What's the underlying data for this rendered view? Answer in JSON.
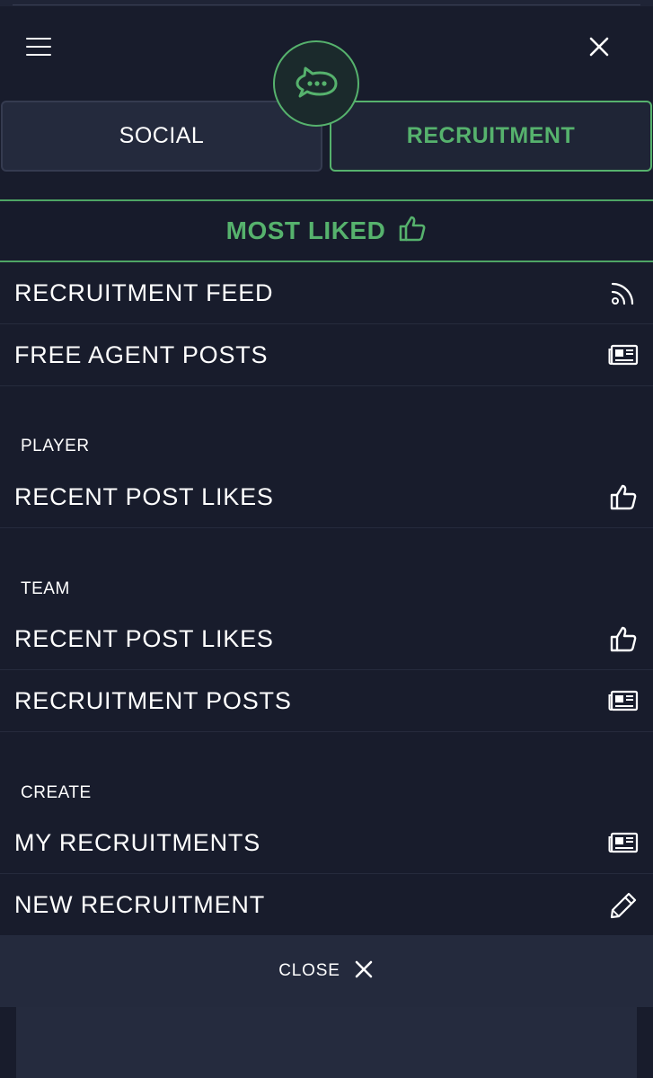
{
  "header": {
    "menu_icon": "hamburger-menu-icon",
    "close_icon": "close-icon",
    "logo_icon": "chat-bubble-logo-icon",
    "accent_color": "#56b26d"
  },
  "tabs": [
    {
      "label": "SOCIAL",
      "active": false
    },
    {
      "label": "RECRUITMENT",
      "active": true
    }
  ],
  "most_liked": {
    "label": "MOST LIKED",
    "icon": "thumbs-up-icon"
  },
  "top_items": [
    {
      "label": "RECRUITMENT FEED",
      "icon": "rss-icon"
    },
    {
      "label": "FREE AGENT POSTS",
      "icon": "newspaper-icon"
    }
  ],
  "sections": [
    {
      "title": "PLAYER",
      "items": [
        {
          "label": "RECENT POST LIKES",
          "icon": "thumbs-up-icon"
        }
      ]
    },
    {
      "title": "TEAM",
      "items": [
        {
          "label": "RECENT POST LIKES",
          "icon": "thumbs-up-icon"
        },
        {
          "label": "RECRUITMENT POSTS",
          "icon": "newspaper-icon"
        }
      ]
    },
    {
      "title": "CREATE",
      "items": [
        {
          "label": "MY RECRUITMENTS",
          "icon": "newspaper-icon"
        },
        {
          "label": "NEW RECRUITMENT",
          "icon": "pencil-icon"
        }
      ]
    }
  ],
  "close_bar": {
    "label": "CLOSE",
    "icon": "close-icon"
  }
}
